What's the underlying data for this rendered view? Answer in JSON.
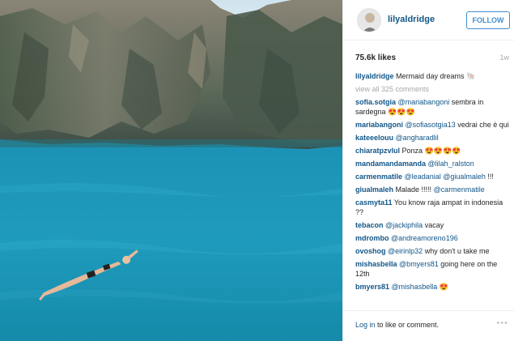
{
  "post": {
    "username": "lilyaldridge",
    "follow_label": "FOLLOW",
    "likes": "75.6k likes",
    "time": "1w",
    "caption_user": "lilyaldridge",
    "caption_text": " Mermaid day dreams 🐚",
    "view_all": "view all 325 comments"
  },
  "comments": [
    {
      "user": "sofia.sotgia",
      "mention": "@mariabangoni",
      "text": " sembra in sardegna 😍😍😍"
    },
    {
      "user": "mariabangoni",
      "mention": "@sofiasotgia13",
      "text": " vedrai che è qui"
    },
    {
      "user": "kateeelouu",
      "mention": "@angharadlil",
      "text": ""
    },
    {
      "user": "chiaratpzvlul",
      "mention": "",
      "text": " Ponza 😍😍😍😍"
    },
    {
      "user": "mandamandamanda",
      "mention": "@lilah_ralston",
      "text": ""
    },
    {
      "user": "carmenmatile",
      "mention": "@leadanial @giualmaleh",
      "text": " !!!"
    },
    {
      "user": "giualmaleh",
      "mention": "",
      "text": " Malade !!!!! ",
      "mention_after": "@carmenmatile"
    },
    {
      "user": "casmyta11",
      "mention": "",
      "text": " You know raja ampat in indonesia ??"
    },
    {
      "user": "tebacon",
      "mention": "@jackiphila",
      "text": " vacay"
    },
    {
      "user": "mdrombo",
      "mention": "@andreamoreno196",
      "text": ""
    },
    {
      "user": "ovoshog",
      "mention": "@eirinlp32",
      "text": " why don't u take me"
    },
    {
      "user": "mishasbella",
      "mention": "@bmyers81",
      "text": " going here on the 12th"
    },
    {
      "user": "bmyers81",
      "mention": "@mishasbella",
      "text": " 😍"
    }
  ],
  "footer": {
    "login_link": "Log in",
    "login_text": " to like or comment.",
    "more": "•••"
  },
  "icons": {
    "more": "more-options-icon"
  }
}
